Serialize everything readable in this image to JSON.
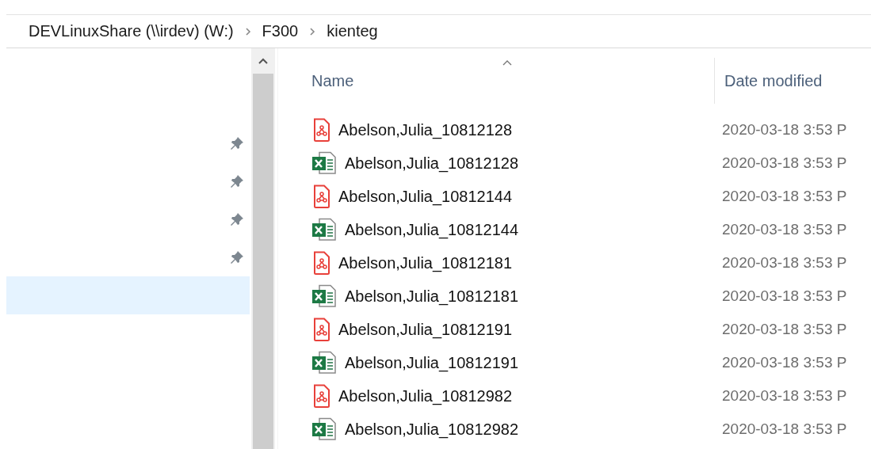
{
  "breadcrumb": [
    "DEVLinuxShare (\\\\irdev) (W:)",
    "F300",
    "kienteg"
  ],
  "nav_pane": {
    "items": [
      {
        "pinned": true,
        "selected": false
      },
      {
        "pinned": true,
        "selected": false
      },
      {
        "pinned": true,
        "selected": false
      },
      {
        "pinned": true,
        "selected": false
      },
      {
        "pinned": false,
        "selected": true
      }
    ]
  },
  "file_list": {
    "columns": [
      "Name",
      "Date modified"
    ],
    "rows": [
      {
        "kind": "pdf",
        "name": "Abelson,Julia_10812128",
        "date_modified": "2020-03-18 3:53 P"
      },
      {
        "kind": "excel",
        "name": "Abelson,Julia_10812128",
        "date_modified": "2020-03-18 3:53 P"
      },
      {
        "kind": "pdf",
        "name": "Abelson,Julia_10812144",
        "date_modified": "2020-03-18 3:53 P"
      },
      {
        "kind": "excel",
        "name": "Abelson,Julia_10812144",
        "date_modified": "2020-03-18 3:53 P"
      },
      {
        "kind": "pdf",
        "name": "Abelson,Julia_10812181",
        "date_modified": "2020-03-18 3:53 P"
      },
      {
        "kind": "excel",
        "name": "Abelson,Julia_10812181",
        "date_modified": "2020-03-18 3:53 P"
      },
      {
        "kind": "pdf",
        "name": "Abelson,Julia_10812191",
        "date_modified": "2020-03-18 3:53 P"
      },
      {
        "kind": "excel",
        "name": "Abelson,Julia_10812191",
        "date_modified": "2020-03-18 3:53 P"
      },
      {
        "kind": "pdf",
        "name": "Abelson,Julia_10812982",
        "date_modified": "2020-03-18 3:53 P"
      },
      {
        "kind": "excel",
        "name": "Abelson,Julia_10812982",
        "date_modified": "2020-03-18 3:53 P"
      }
    ]
  }
}
